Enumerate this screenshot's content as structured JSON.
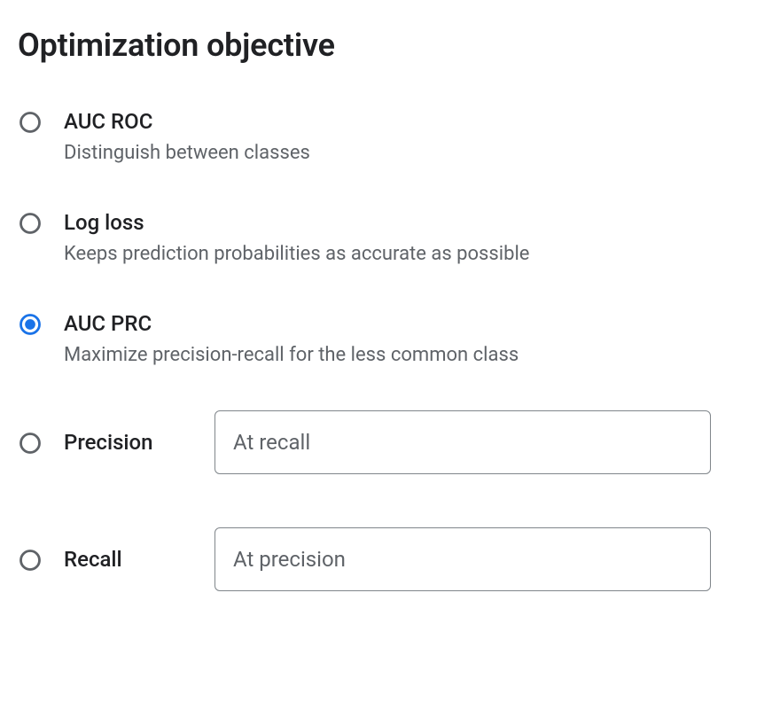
{
  "heading": "Optimization objective",
  "options": {
    "auc_roc": {
      "label": "AUC ROC",
      "desc": "Distinguish between classes",
      "selected": false
    },
    "log_loss": {
      "label": "Log loss",
      "desc": "Keeps prediction probabilities as accurate as possible",
      "selected": false
    },
    "auc_prc": {
      "label": "AUC PRC",
      "desc": "Maximize precision-recall for the less common class",
      "selected": true
    },
    "precision": {
      "label": "Precision",
      "input_placeholder": "At recall",
      "input_value": "",
      "selected": false
    },
    "recall": {
      "label": "Recall",
      "input_placeholder": "At precision",
      "input_value": "",
      "selected": false
    }
  },
  "colors": {
    "radio_unselected": "#5f6368",
    "radio_selected": "#1a73e8"
  }
}
